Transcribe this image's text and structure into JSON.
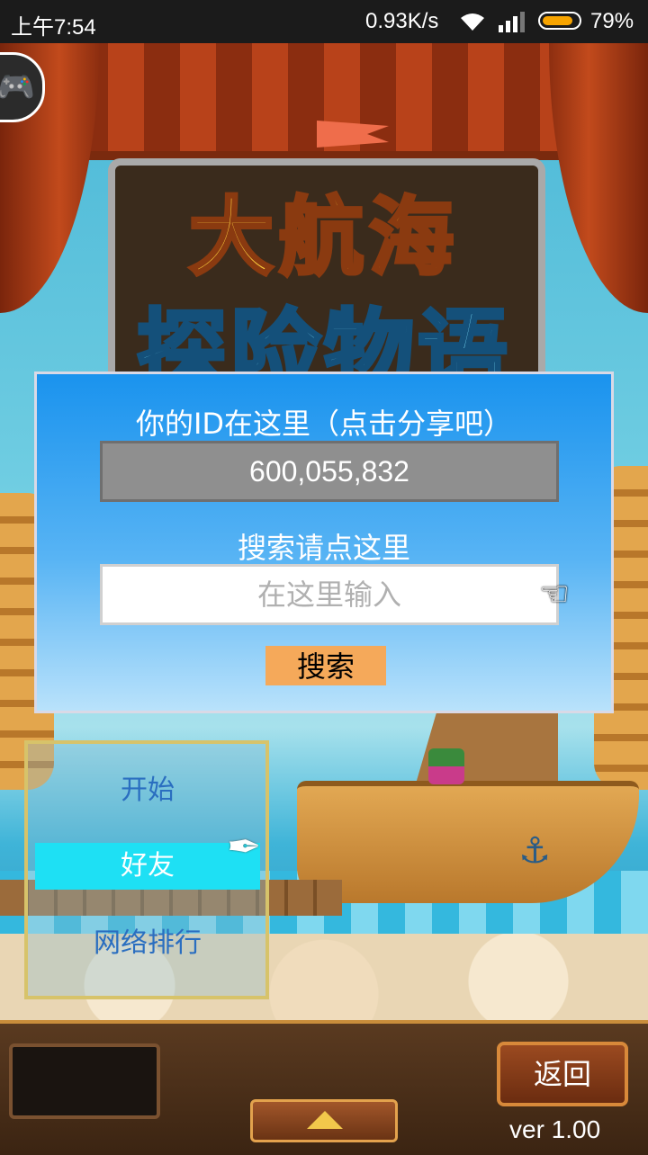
{
  "status_bar": {
    "time": "上午7:54",
    "network_speed": "0.93K/s",
    "battery_percent": "79%",
    "battery_level": 0.79,
    "battery_color": "#f7a400"
  },
  "game": {
    "logo_line1": "大航海",
    "logo_line2": "探险物语"
  },
  "id_dialog": {
    "id_label": "你的ID在这里（点击分享吧）",
    "id_value": "600,055,832",
    "search_label": "搜索请点这里",
    "search_placeholder": "在这里输入",
    "search_button": "搜索",
    "pointer_icon": "hand-pointer-icon"
  },
  "menu": {
    "items": [
      {
        "label": "开始",
        "selected": false
      },
      {
        "label": "好友",
        "selected": true
      },
      {
        "label": "网络排行",
        "selected": false
      }
    ],
    "selected_color": "#1ee0f4",
    "cursor_icon": "quill-icon"
  },
  "bottom_bar": {
    "back_label": "返回",
    "version": "ver 1.00"
  }
}
